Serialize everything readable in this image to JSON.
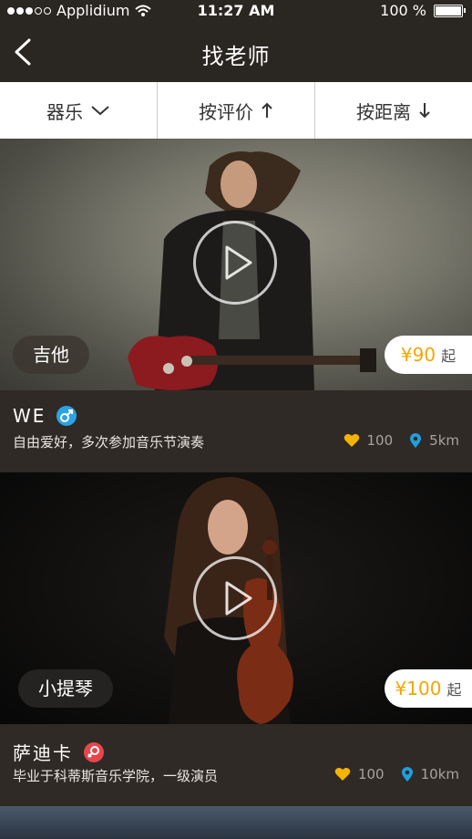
{
  "status": {
    "carrier": "Applidium",
    "time": "11:27 AM",
    "battery": "100 %"
  },
  "nav": {
    "title": "找老师"
  },
  "filters": [
    {
      "label": "器乐",
      "icon": "chevron-down"
    },
    {
      "label": "按评价",
      "icon": "arrow-up"
    },
    {
      "label": "按距离",
      "icon": "arrow-down"
    }
  ],
  "teachers": [
    {
      "name": "WE",
      "gender": "male",
      "gender_color": "#2aa3e6",
      "instrument": "吉他",
      "price": "¥90",
      "price_unit": "起",
      "description": "自由爱好，多次参加音乐节演奏",
      "likes": "100",
      "distance": "5km"
    },
    {
      "name": "萨迪卡",
      "gender": "female",
      "gender_color": "#e6474b",
      "instrument": "小提琴",
      "price": "¥100",
      "price_unit": "起",
      "description": "毕业于科蒂斯音乐学院，一级演员",
      "likes": "100",
      "distance": "10km"
    }
  ],
  "colors": {
    "price_accent": "#f3a600",
    "heart": "#f4b400",
    "location": "#1e9fe0",
    "dark_bg": "#2f2a26"
  }
}
